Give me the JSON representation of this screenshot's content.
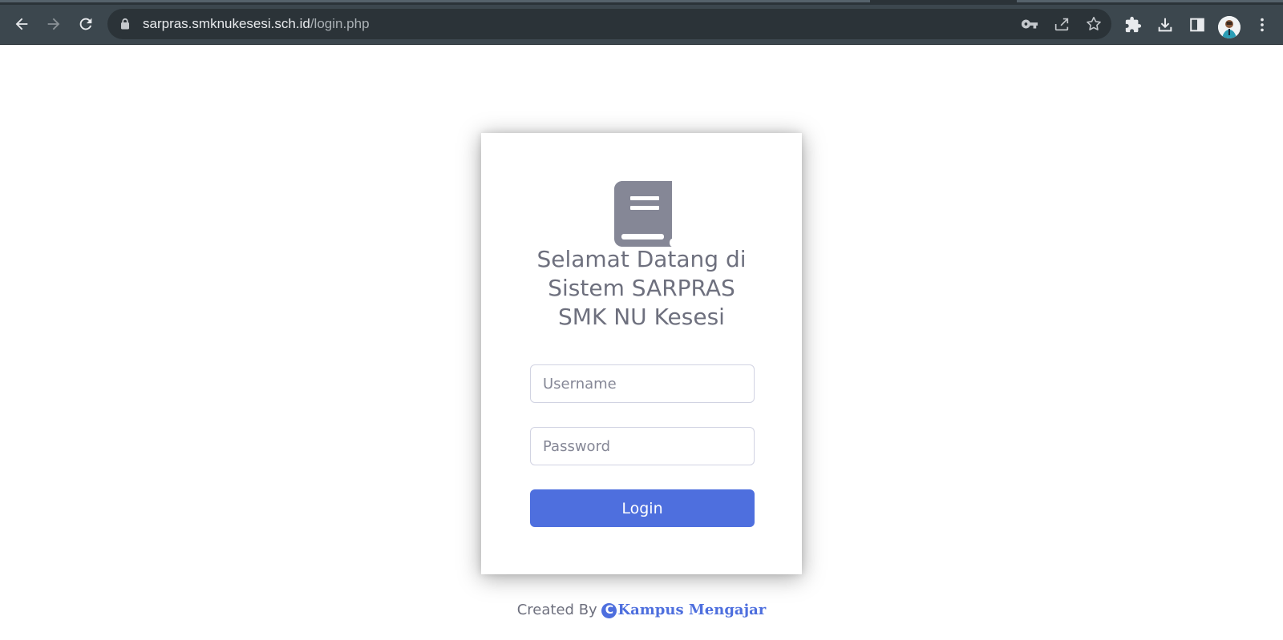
{
  "browser": {
    "url_domain": "sarpras.smknukesesi.sch.id",
    "url_path": "/login.php",
    "icons": [
      "back-arrow-icon",
      "forward-arrow-icon",
      "reload-icon",
      "lock-icon",
      "key-icon",
      "share-icon",
      "star-icon",
      "extensions-icon",
      "download-icon",
      "side-panel-icon",
      "profile-avatar",
      "more-menu-icon"
    ]
  },
  "login": {
    "welcome_line1": "Selamat Datang di",
    "welcome_line2": "Sistem SARPRAS",
    "welcome_line3": "SMK NU Kesesi",
    "username_placeholder": "Username",
    "password_placeholder": "Password",
    "login_label": "Login"
  },
  "footer": {
    "created_by": "Created By",
    "brand_mark": "C",
    "brand_name": "Kampus Mengajar"
  },
  "colors": {
    "primary": "#4e6fde",
    "text_muted": "#6e707e",
    "icon_gray": "#858796",
    "chrome_toolbar": "#3c474e",
    "chrome_omnibox": "#2b3338"
  }
}
